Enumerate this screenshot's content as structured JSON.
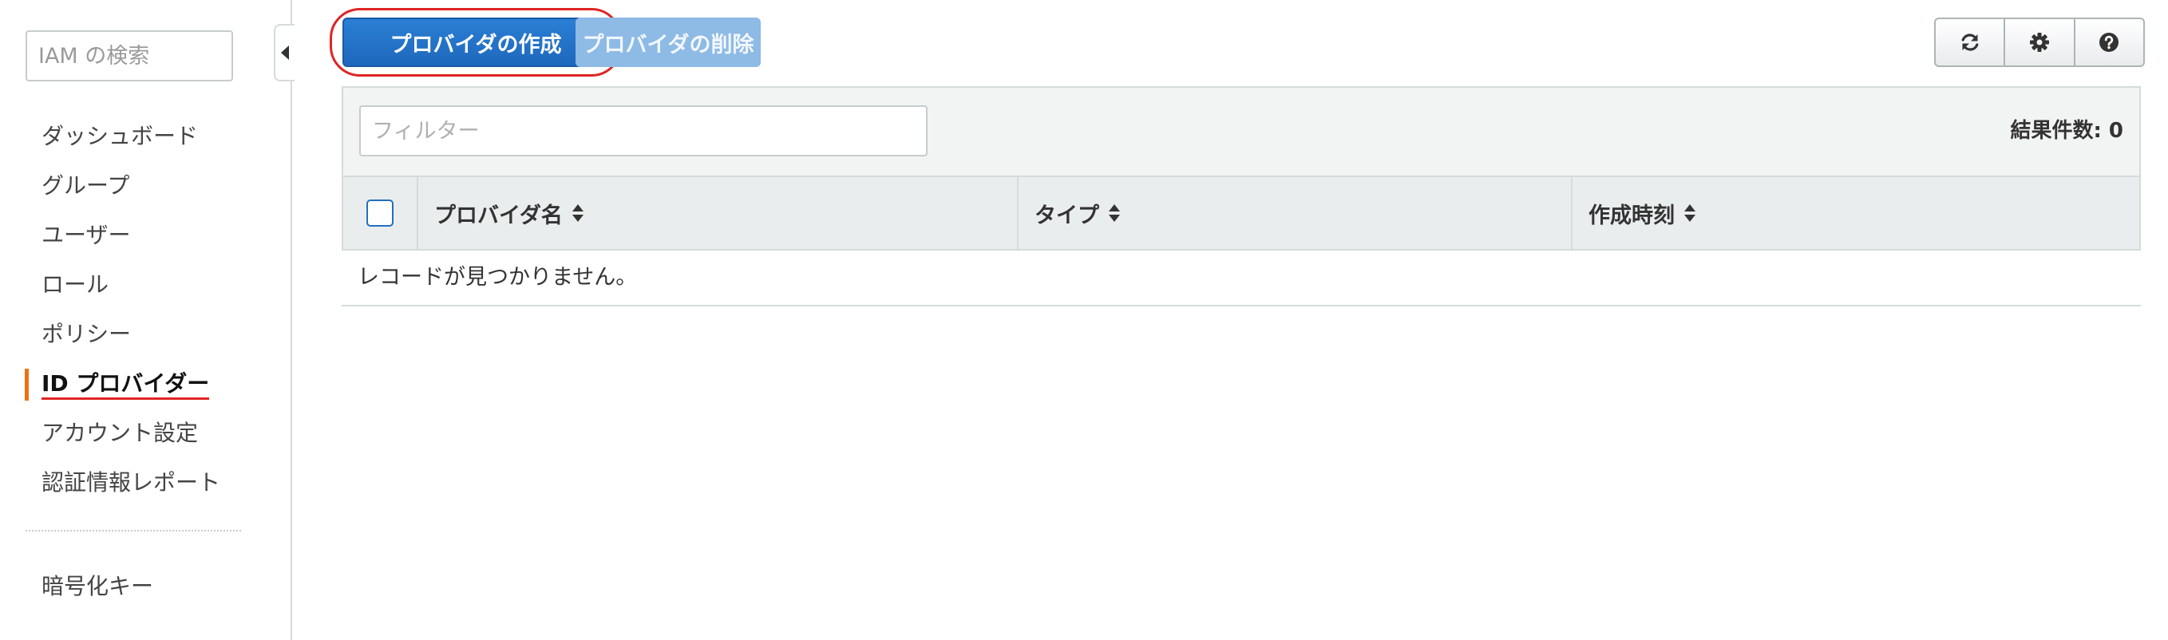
{
  "sidebar": {
    "search_placeholder": "IAM の検索",
    "items": [
      {
        "label": "ダッシュボード"
      },
      {
        "label": "グループ"
      },
      {
        "label": "ユーザー"
      },
      {
        "label": "ロール"
      },
      {
        "label": "ポリシー"
      },
      {
        "label": "ID プロバイダー",
        "active": true
      },
      {
        "label": "アカウント設定"
      },
      {
        "label": "認証情報レポート"
      }
    ],
    "extra_items": [
      {
        "label": "暗号化キー"
      }
    ]
  },
  "toolbar": {
    "create_label": "プロバイダの作成",
    "delete_label": "プロバイダの削除",
    "icons": [
      "refresh-icon",
      "gear-icon",
      "help-icon"
    ]
  },
  "table": {
    "filter_placeholder": "フィルター",
    "result_count": "結果件数: 0",
    "columns": [
      {
        "label": "プロバイダ名"
      },
      {
        "label": "タイプ"
      },
      {
        "label": "作成時刻"
      }
    ],
    "empty_message": "レコードが見つかりません。"
  },
  "colors": {
    "primary_button": "#1e68bd",
    "disabled_button": "#8ebae6",
    "active_nav_accent": "#ec7211",
    "annotation_red": "#e02424"
  }
}
